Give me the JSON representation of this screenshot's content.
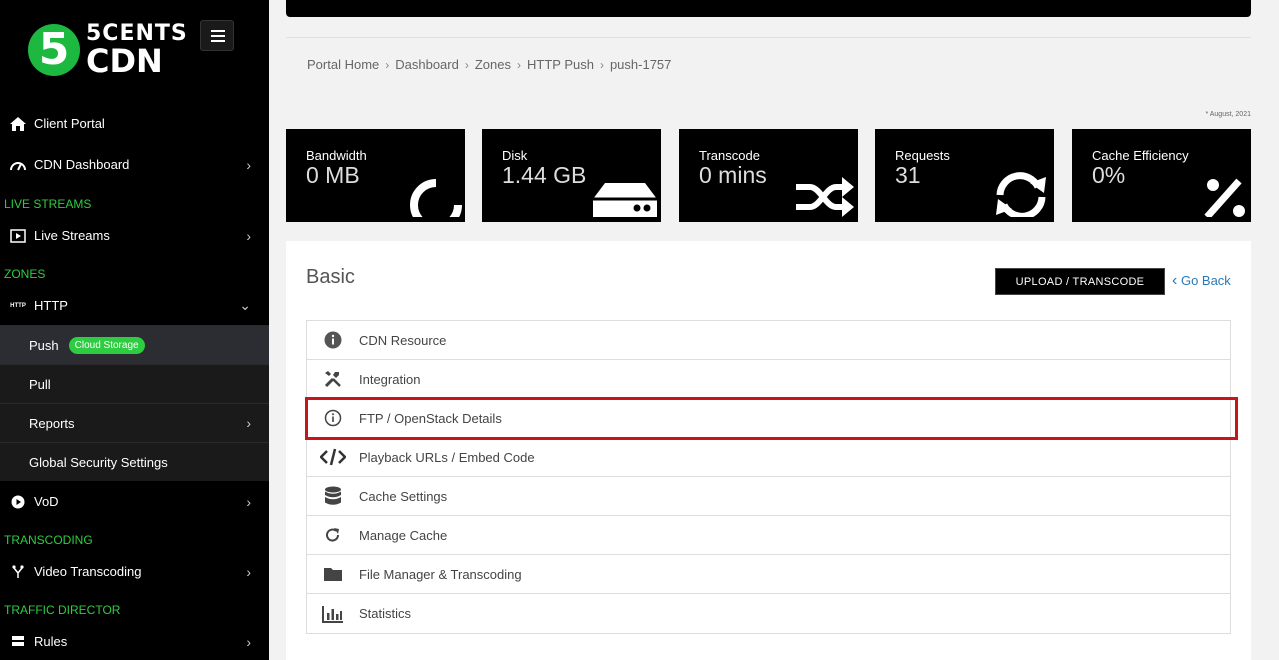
{
  "brand": {
    "logo_digit": "5",
    "logo_line1": "5CENTS",
    "logo_line2": "CDN"
  },
  "sidebar": {
    "client_portal": "Client Portal",
    "cdn_dashboard": "CDN Dashboard",
    "sections": {
      "live_streams": "LIVE STREAMS",
      "zones": "ZONES",
      "transcoding": "TRANSCODING",
      "traffic_director": "TRAFFIC DIRECTOR"
    },
    "live_streams": "Live Streams",
    "http": "HTTP",
    "http_icon_text": "HTTP",
    "push": "Push",
    "push_badge": "Cloud Storage",
    "pull": "Pull",
    "reports": "Reports",
    "global_security": "Global Security Settings",
    "vod": "VoD",
    "video_transcoding": "Video Transcoding",
    "rules": "Rules"
  },
  "breadcrumb": [
    "Portal Home",
    "Dashboard",
    "Zones",
    "HTTP Push",
    "push-1757"
  ],
  "note": "* August, 2021",
  "stats": [
    {
      "label": "Bandwidth",
      "value": "0 MB",
      "icon": "circle-notch-icon"
    },
    {
      "label": "Disk",
      "value": "1.44 GB",
      "icon": "hdd-icon"
    },
    {
      "label": "Transcode",
      "value": "0 mins",
      "icon": "random-icon"
    },
    {
      "label": "Requests",
      "value": "31",
      "icon": "sync-icon"
    },
    {
      "label": "Cache Efficiency",
      "value": "0%",
      "icon": "percent-icon"
    }
  ],
  "panel": {
    "title": "Basic",
    "upload_button": "UPLOAD / TRANSCODE",
    "go_back": "Go Back",
    "items": [
      {
        "label": "CDN Resource",
        "icon": "info-circle-icon"
      },
      {
        "label": "Integration",
        "icon": "tools-icon"
      },
      {
        "label": "FTP / OpenStack Details",
        "icon": "info-outline-icon"
      },
      {
        "label": "Playback URLs / Embed Code",
        "icon": "code-icon"
      },
      {
        "label": "Cache Settings",
        "icon": "database-icon"
      },
      {
        "label": "Manage Cache",
        "icon": "redo-icon"
      },
      {
        "label": "File Manager & Transcoding",
        "icon": "folder-icon"
      },
      {
        "label": "Statistics",
        "icon": "bar-chart-icon"
      }
    ]
  },
  "colors": {
    "accent_green": "#2ecc40",
    "highlight_red": "#c8151b",
    "link_blue": "#2a7ab8"
  }
}
